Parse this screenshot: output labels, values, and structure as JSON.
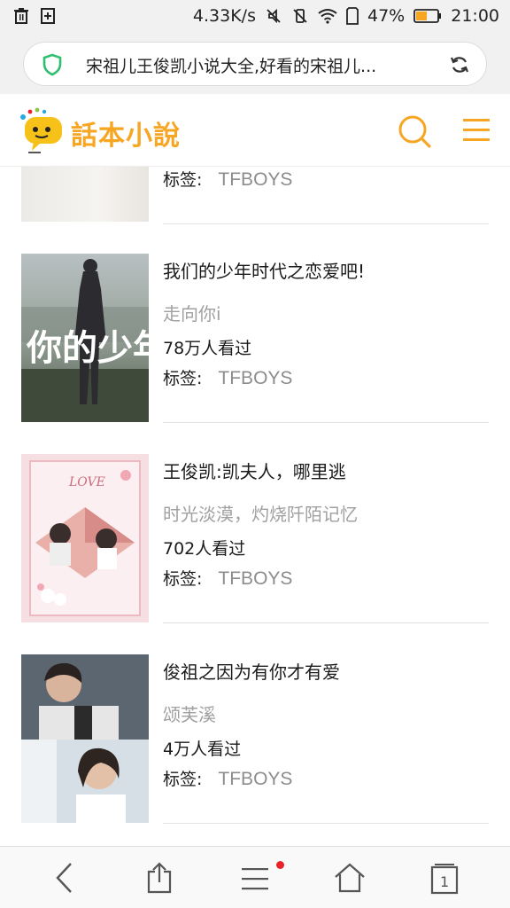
{
  "status_bar": {
    "speed": "4.33K/s",
    "battery": "47%",
    "time": "21:00"
  },
  "address_bar": {
    "url_text": "宋祖儿王俊凯小说大全,好看的宋祖儿..."
  },
  "site_header": {
    "logo_text": "話本小說"
  },
  "partial_item": {
    "tag_label": "标签:",
    "tag_value": "TFBOYS"
  },
  "items": [
    {
      "title": "我们的少年时代之恋爱吧!",
      "author": "走向你i",
      "views": "78万人看过",
      "tag_label": "标签:",
      "tag_value": "TFBOYS"
    },
    {
      "title": "王俊凯:凯夫人，哪里逃",
      "author": "时光淡漠，灼烧阡陌记忆",
      "views": "702人看过",
      "tag_label": "标签:",
      "tag_value": "TFBOYS"
    },
    {
      "title": "俊祖之因为有你才有爱",
      "author": "颂芙溪",
      "views": "4万人看过",
      "tag_label": "标签:",
      "tag_value": "TFBOYS"
    }
  ],
  "covers": {
    "cover_1_text": "你的少年时",
    "cover_2_text": "LOVE"
  },
  "bottom_nav": {
    "tabs_count": "1"
  },
  "colors": {
    "accent": "#f6a623",
    "shield": "#2fbf71",
    "notification_dot": "#e8232a"
  }
}
